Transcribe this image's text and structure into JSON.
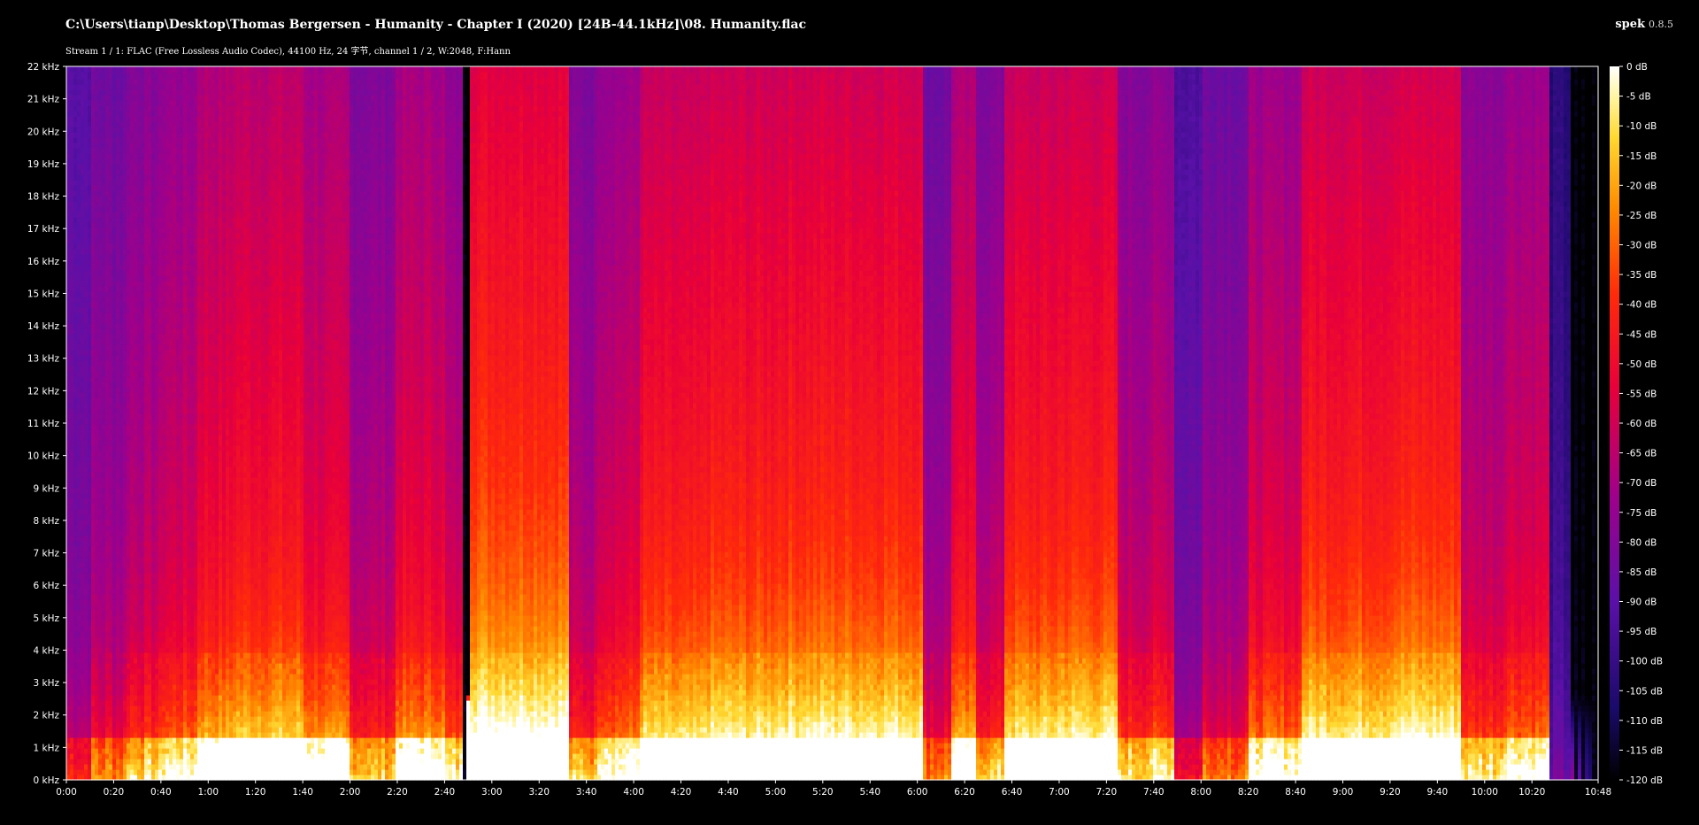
{
  "header": {
    "file_path": "C:\\Users\\tianp\\Desktop\\Thomas Bergersen - Humanity - Chapter I (2020) [24B-44.1kHz]\\08. Humanity.flac",
    "app_name": "spek",
    "app_version": "0.8.5",
    "stream_info": "Stream 1 / 1: FLAC (Free Lossless Audio Codec), 44100 Hz, 24 字节, channel 1 / 2, W:2048, F:Hann"
  },
  "chart_data": {
    "type": "heatmap",
    "title": "C:\\Users\\tianp\\Desktop\\Thomas Bergersen - Humanity - Chapter I (2020) [24B-44.1kHz]\\08. Humanity.flac",
    "xlabel": "",
    "ylabel": "",
    "x_range_seconds": [
      0,
      648
    ],
    "y_range_khz": [
      0,
      22
    ],
    "color_range_db": [
      -120,
      0
    ],
    "y_ticks": [
      "0 kHz",
      "1 kHz",
      "2 kHz",
      "3 kHz",
      "4 kHz",
      "5 kHz",
      "6 kHz",
      "7 kHz",
      "8 kHz",
      "9 kHz",
      "10 kHz",
      "11 kHz",
      "12 kHz",
      "13 kHz",
      "14 kHz",
      "15 kHz",
      "16 kHz",
      "17 kHz",
      "18 kHz",
      "19 kHz",
      "20 kHz",
      "21 kHz",
      "22 kHz"
    ],
    "x_ticks": [
      "0:00",
      "0:20",
      "0:40",
      "1:00",
      "1:20",
      "1:40",
      "2:00",
      "2:20",
      "2:40",
      "3:00",
      "3:20",
      "3:40",
      "4:00",
      "4:20",
      "4:40",
      "5:00",
      "5:20",
      "5:40",
      "6:00",
      "6:20",
      "6:40",
      "7:00",
      "7:20",
      "7:40",
      "8:00",
      "8:20",
      "8:40",
      "9:00",
      "9:20",
      "9:40",
      "10:00",
      "10:20",
      "10:48"
    ],
    "colorbar_ticks": [
      "0 dB",
      "-5 dB",
      "-10 dB",
      "-15 dB",
      "-20 dB",
      "-25 dB",
      "-30 dB",
      "-35 dB",
      "-40 dB",
      "-45 dB",
      "-50 dB",
      "-55 dB",
      "-60 dB",
      "-65 dB",
      "-70 dB",
      "-75 dB",
      "-80 dB",
      "-85 dB",
      "-90 dB",
      "-95 dB",
      "-100 dB",
      "-105 dB",
      "-110 dB",
      "-115 dB",
      "-120 dB"
    ],
    "colormap": [
      "#ffffff",
      "#fff6a8",
      "#ffd830",
      "#ff8a00",
      "#ff2a0a",
      "#e8003a",
      "#a0008a",
      "#5a10a8",
      "#1a0a6a",
      "#000000"
    ],
    "intensity_segments": [
      {
        "start": 0,
        "end": 10,
        "level": 0.42
      },
      {
        "start": 10,
        "end": 25,
        "level": 0.5
      },
      {
        "start": 25,
        "end": 40,
        "level": 0.58
      },
      {
        "start": 40,
        "end": 55,
        "level": 0.64
      },
      {
        "start": 55,
        "end": 70,
        "level": 0.74
      },
      {
        "start": 70,
        "end": 100,
        "level": 0.78
      },
      {
        "start": 100,
        "end": 120,
        "level": 0.7
      },
      {
        "start": 120,
        "end": 140,
        "level": 0.56
      },
      {
        "start": 140,
        "end": 160,
        "level": 0.7
      },
      {
        "start": 160,
        "end": 168,
        "level": 0.6
      },
      {
        "start": 168,
        "end": 171,
        "level": 0.05
      },
      {
        "start": 171,
        "end": 212,
        "level": 0.92
      },
      {
        "start": 212,
        "end": 225,
        "level": 0.55
      },
      {
        "start": 225,
        "end": 243,
        "level": 0.66
      },
      {
        "start": 243,
        "end": 270,
        "level": 0.8
      },
      {
        "start": 270,
        "end": 300,
        "level": 0.84
      },
      {
        "start": 300,
        "end": 362,
        "level": 0.86
      },
      {
        "start": 362,
        "end": 375,
        "level": 0.5
      },
      {
        "start": 375,
        "end": 385,
        "level": 0.72
      },
      {
        "start": 385,
        "end": 397,
        "level": 0.56
      },
      {
        "start": 397,
        "end": 420,
        "level": 0.82
      },
      {
        "start": 420,
        "end": 445,
        "level": 0.84
      },
      {
        "start": 445,
        "end": 458,
        "level": 0.58
      },
      {
        "start": 458,
        "end": 468,
        "level": 0.6
      },
      {
        "start": 468,
        "end": 480,
        "level": 0.38
      },
      {
        "start": 480,
        "end": 500,
        "level": 0.5
      },
      {
        "start": 500,
        "end": 522,
        "level": 0.66
      },
      {
        "start": 522,
        "end": 560,
        "level": 0.84
      },
      {
        "start": 560,
        "end": 590,
        "level": 0.86
      },
      {
        "start": 590,
        "end": 608,
        "level": 0.6
      },
      {
        "start": 608,
        "end": 627,
        "level": 0.66
      },
      {
        "start": 627,
        "end": 636,
        "level": 0.22
      },
      {
        "start": 636,
        "end": 648,
        "level": 0.0
      }
    ]
  }
}
